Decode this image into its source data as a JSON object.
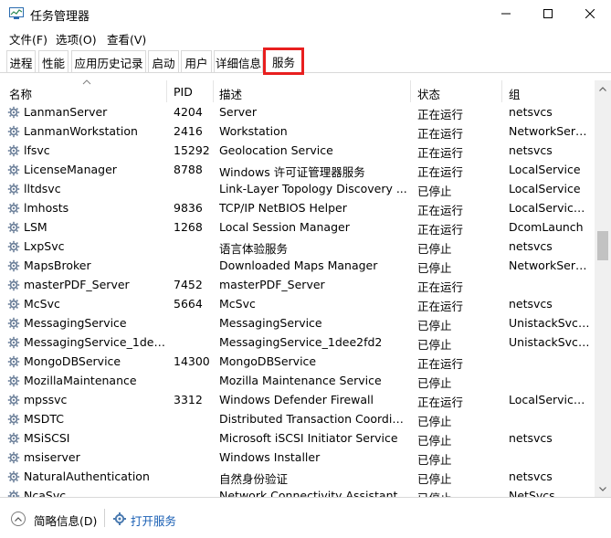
{
  "window": {
    "title": "任务管理器"
  },
  "menu": {
    "file": "文件(F)",
    "options": "选项(O)",
    "view": "查看(V)"
  },
  "tabs": {
    "processes": "进程",
    "performance": "性能",
    "app_history": "应用历史记录",
    "startup": "启动",
    "users": "用户",
    "details": "详细信息",
    "services": "服务"
  },
  "columns": {
    "name": "名称",
    "pid": "PID",
    "description": "描述",
    "status": "状态",
    "group": "组"
  },
  "services": [
    {
      "name": "LanmanServer",
      "pid": "4204",
      "description": "Server",
      "status": "正在运行",
      "group": "netsvcs"
    },
    {
      "name": "LanmanWorkstation",
      "pid": "2416",
      "description": "Workstation",
      "status": "正在运行",
      "group": "NetworkServ..."
    },
    {
      "name": "lfsvc",
      "pid": "15292",
      "description": "Geolocation Service",
      "status": "正在运行",
      "group": "netsvcs"
    },
    {
      "name": "LicenseManager",
      "pid": "8788",
      "description": "Windows 许可证管理器服务",
      "status": "正在运行",
      "group": "LocalService"
    },
    {
      "name": "lltdsvc",
      "pid": "",
      "description": "Link-Layer Topology Discovery ...",
      "status": "已停止",
      "group": "LocalService"
    },
    {
      "name": "lmhosts",
      "pid": "9836",
      "description": "TCP/IP NetBIOS Helper",
      "status": "正在运行",
      "group": "LocalService..."
    },
    {
      "name": "LSM",
      "pid": "1268",
      "description": "Local Session Manager",
      "status": "正在运行",
      "group": "DcomLaunch"
    },
    {
      "name": "LxpSvc",
      "pid": "",
      "description": "语言体验服务",
      "status": "已停止",
      "group": "netsvcs"
    },
    {
      "name": "MapsBroker",
      "pid": "",
      "description": "Downloaded Maps Manager",
      "status": "已停止",
      "group": "NetworkServ..."
    },
    {
      "name": "masterPDF_Server",
      "pid": "7452",
      "description": "masterPDF_Server",
      "status": "正在运行",
      "group": ""
    },
    {
      "name": "McSvc",
      "pid": "5664",
      "description": "McSvc",
      "status": "正在运行",
      "group": "netsvcs"
    },
    {
      "name": "MessagingService",
      "pid": "",
      "description": "MessagingService",
      "status": "已停止",
      "group": "UnistackSvcG..."
    },
    {
      "name": "MessagingService_1dee...",
      "pid": "",
      "description": "MessagingService_1dee2fd2",
      "status": "已停止",
      "group": "UnistackSvcG..."
    },
    {
      "name": "MongoDBService",
      "pid": "14300",
      "description": "MongoDBService",
      "status": "正在运行",
      "group": ""
    },
    {
      "name": "MozillaMaintenance",
      "pid": "",
      "description": "Mozilla Maintenance Service",
      "status": "已停止",
      "group": ""
    },
    {
      "name": "mpssvc",
      "pid": "3312",
      "description": "Windows Defender Firewall",
      "status": "正在运行",
      "group": "LocalService..."
    },
    {
      "name": "MSDTC",
      "pid": "",
      "description": "Distributed Transaction Coordina...",
      "status": "已停止",
      "group": ""
    },
    {
      "name": "MSiSCSI",
      "pid": "",
      "description": "Microsoft iSCSI Initiator Service",
      "status": "已停止",
      "group": "netsvcs"
    },
    {
      "name": "msiserver",
      "pid": "",
      "description": "Windows Installer",
      "status": "已停止",
      "group": ""
    },
    {
      "name": "NaturalAuthentication",
      "pid": "",
      "description": "自然身份验证",
      "status": "已停止",
      "group": "netsvcs"
    },
    {
      "name": "NcaSvc",
      "pid": "",
      "description": "Network Connectivity Assistant",
      "status": "已停止",
      "group": "NetSvcs"
    }
  ],
  "footer": {
    "fewer_details": "简略信息(D)",
    "open_services": "打开服务"
  },
  "colors": {
    "highlight_border": "#e81f1f",
    "link": "#1a5fb4"
  }
}
